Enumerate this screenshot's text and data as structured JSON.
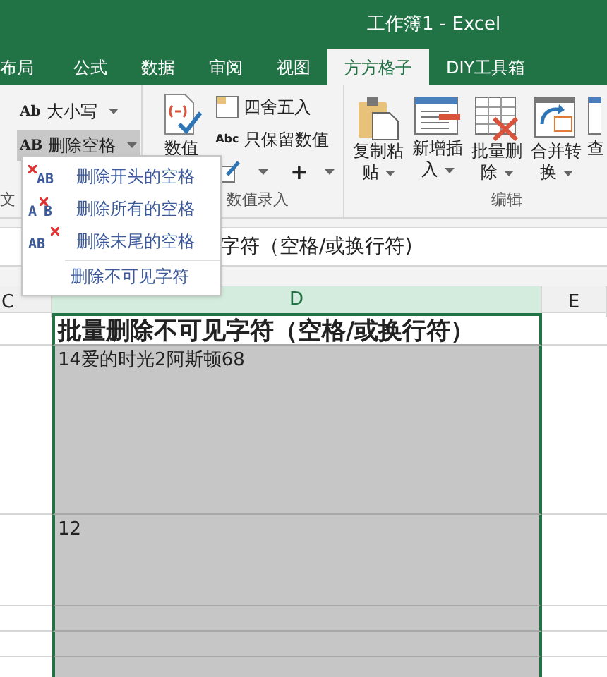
{
  "window": {
    "title": "工作簿1 - Excel"
  },
  "ribbon_tabs": [
    {
      "label": "布局",
      "selected": false
    },
    {
      "label": "公式",
      "selected": false
    },
    {
      "label": "数据",
      "selected": false
    },
    {
      "label": "审阅",
      "selected": false
    },
    {
      "label": "视图",
      "selected": false
    },
    {
      "label": "方方格子",
      "selected": true
    },
    {
      "label": "DIY工具箱",
      "selected": false
    }
  ],
  "text_group": {
    "label": "文",
    "buttons": [
      {
        "icon_text": "Ab",
        "label": "大小写",
        "highlighted": false
      },
      {
        "icon_text": "AB",
        "label": "删除空格",
        "highlighted": true
      }
    ]
  },
  "number_group": {
    "label": "数值录入",
    "big_button": "数值",
    "buttons": [
      {
        "kind": "round",
        "label": "四舍五入"
      },
      {
        "kind": "keep",
        "icon_text": "Abc",
        "label": "只保留数值"
      }
    ],
    "plus": "+"
  },
  "edit_group": {
    "label": "编辑",
    "buttons": [
      {
        "kind": "paste",
        "lines": [
          "复制粘",
          "贴"
        ]
      },
      {
        "kind": "insert",
        "lines": [
          "新增插",
          "入"
        ]
      },
      {
        "kind": "delete",
        "lines": [
          "批量删",
          "除"
        ]
      },
      {
        "kind": "merge",
        "lines": [
          "合并转",
          "换"
        ]
      },
      {
        "kind": "find",
        "lines": [
          "查"
        ]
      }
    ]
  },
  "dropdown_menu": {
    "items": [
      {
        "kind": "leading",
        "icon_text": "AB",
        "label": "删除开头的空格"
      },
      {
        "kind": "all",
        "icon_text": "AB",
        "label": "删除所有的空格"
      },
      {
        "kind": "trailing",
        "icon_text": "AB",
        "label": "删除末尾的空格"
      },
      {
        "kind": "invisible",
        "label": "删除不可见字符"
      }
    ]
  },
  "formula_bar": {
    "value": "字符（空格/或换行符)"
  },
  "sheet": {
    "columns": [
      {
        "label": "C",
        "selected": false
      },
      {
        "label": "D",
        "selected": true
      },
      {
        "label": "E",
        "selected": false
      }
    ],
    "rows": [
      {
        "kind": "header",
        "value": "批量删除不可见字符（空格/或换行符）"
      },
      {
        "kind": "tall",
        "value": "14爱的时光2阿斯顿68"
      },
      {
        "kind": "medium",
        "value": "12"
      },
      {
        "kind": "empty"
      },
      {
        "kind": "empty"
      },
      {
        "kind": "empty"
      }
    ]
  }
}
